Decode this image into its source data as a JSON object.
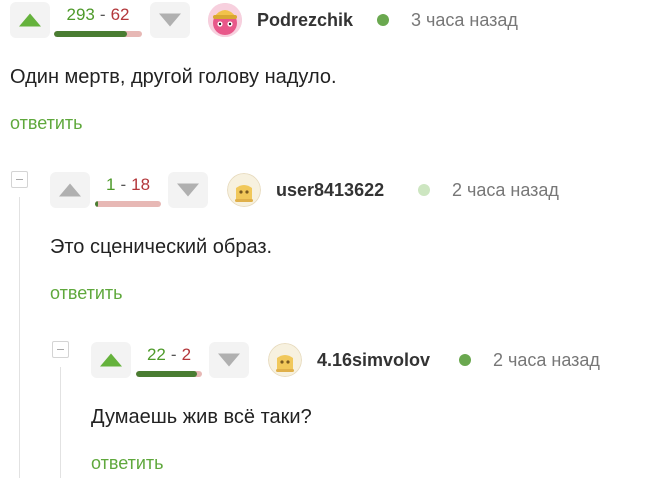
{
  "comments": [
    {
      "rating_plus": "293",
      "rating_minus": "62",
      "rating_sep": "-",
      "rating_fraction": 0.825,
      "username": "Podrezchik",
      "time": "3 часа назад",
      "status_color": "#6aa84f",
      "text": "Один мертв, другой голову надуло.",
      "reply_label": "ответить",
      "avatar": "pink-creature-avatar"
    },
    {
      "rating_plus": "1",
      "rating_minus": "18",
      "rating_sep": "-",
      "rating_fraction": 0.053,
      "username": "user8413622",
      "time": "2 часа назад",
      "status_color": "#cde6c1",
      "text": "Это сценический образ.",
      "reply_label": "ответить",
      "avatar": "default-user-avatar"
    },
    {
      "rating_plus": "22",
      "rating_minus": "2",
      "rating_sep": "-",
      "rating_fraction": 0.917,
      "username": "4.16simvolov",
      "time": "2 часа назад",
      "status_color": "#6aa84f",
      "text": "Думаешь жив всё таки?",
      "reply_label": "ответить",
      "avatar": "default-user-avatar"
    }
  ],
  "colors": {
    "accent_green": "#5fa83c",
    "plus_green": "#4e9a2a",
    "minus_red": "#b3373b"
  },
  "icons": {
    "upvote": "triangle-up-icon",
    "downvote": "triangle-down-icon",
    "collapse": "collapse-minus-icon"
  }
}
